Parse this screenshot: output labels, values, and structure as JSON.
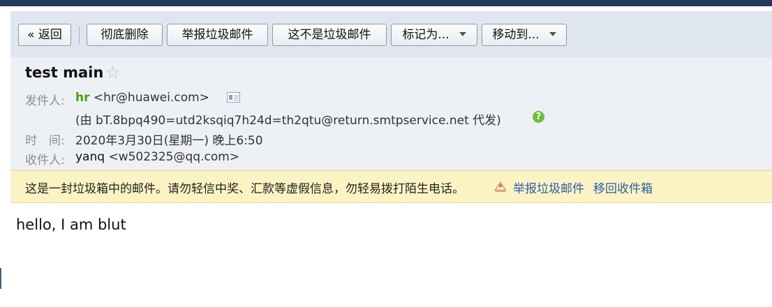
{
  "toolbar": {
    "back_label": "« 返回",
    "delete_label": "彻底删除",
    "report_spam_label": "举报垃圾邮件",
    "not_spam_label": "这不是垃圾邮件",
    "mark_as_label": "标记为...",
    "move_to_label": "移动到..."
  },
  "email": {
    "subject": "test main",
    "from_label": "发件人:",
    "from_name": "hr",
    "from_address": "<hr@huawei.com>",
    "on_behalf": "(由 bT.8bpq490=utd2ksqiq7h24d=th2qtu@return.smtpservice.net 代发)",
    "time_label": "时　间:",
    "time_value": "2020年3月30日(星期一) 晚上6:50",
    "to_label": "收件人:",
    "to_name": "yanq",
    "to_address": "<w502325@qq.com>",
    "body": "hello, I am blut"
  },
  "spam_banner": {
    "message": "这是一封垃圾箱中的邮件。请勿轻信中奖、汇款等虚假信息，勿轻易拨打陌生电话。",
    "report_link": "举报垃圾邮件",
    "move_back_link": "移回收件箱"
  },
  "icons": {
    "star": "star-outline-icon",
    "contact_card": "contact-card-icon",
    "help": "help-icon",
    "report": "report-flag-icon"
  },
  "colors": {
    "topbar": "#243a5a",
    "toolbar_bg": "#dfe6ef",
    "header_bg": "#edf0f4",
    "sender_name": "#4d9a18",
    "banner_bg": "#fcf3c4",
    "link": "#2c5ea7"
  }
}
